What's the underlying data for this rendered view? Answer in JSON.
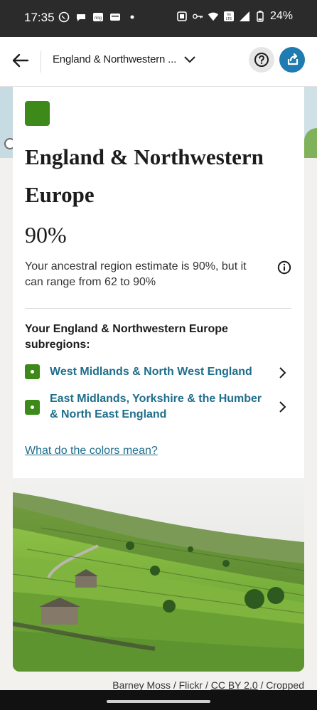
{
  "status_bar": {
    "time": "17:35",
    "battery": "24%",
    "left_icons": [
      "whatsapp-icon",
      "chat-icon",
      "ring-icon",
      "message-icon",
      "dot-icon"
    ],
    "right_icons": [
      "cast-icon",
      "key-icon",
      "wifi-icon",
      "volte-icon",
      "signal-icon",
      "battery-icon"
    ]
  },
  "header": {
    "region_label": "England & Northwestern ...",
    "back_icon": "arrow-left-icon",
    "dropdown_icon": "chevron-down-icon",
    "help_icon": "question-icon",
    "share_icon": "share-icon",
    "accent": "#1f7bb0"
  },
  "region": {
    "title": "England & Northwestern Europe",
    "percent": "90%",
    "estimate_text": "Your ancestral region estimate is 90%, but it can range from 62 to 90%",
    "swatch_color": "#3d8a1a"
  },
  "subregions": {
    "heading": "Your England & Northwestern Europe subregions:",
    "items": [
      {
        "label": "West Midlands & North West England"
      },
      {
        "label": "East Midlands, Yorkshire & the Humber & North East England"
      }
    ]
  },
  "colors_link": "What do the colors mean?",
  "photo_credit": {
    "author": "Barney Moss / Flickr / ",
    "license": "CC BY 2.0",
    "suffix": " / Cropped"
  }
}
